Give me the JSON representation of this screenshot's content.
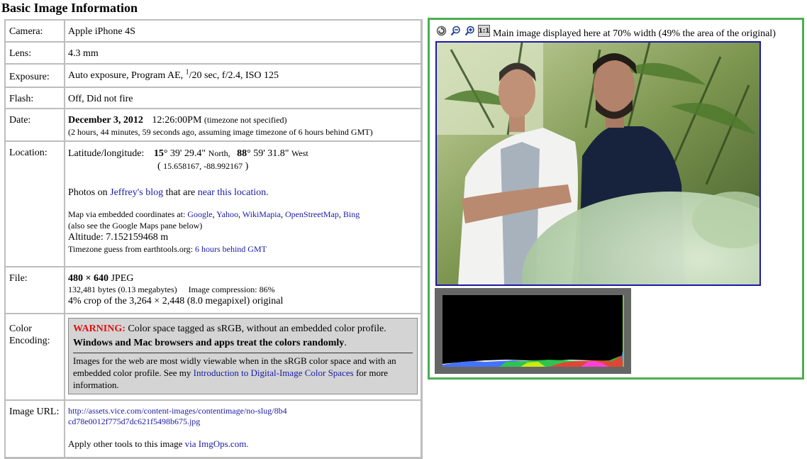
{
  "page_title": "Basic Image Information",
  "camera": {
    "label": "Camera:",
    "value": "Apple iPhone 4S"
  },
  "lens": {
    "label": "Lens:",
    "value": "4.3 mm"
  },
  "exposure": {
    "label": "Exposure:",
    "text_before": "Auto exposure, Program AE,",
    "frac_num": "1",
    "text_after": "/20 sec, f/2.4, ISO 125"
  },
  "flash": {
    "label": "Flash:",
    "value": "Off, Did not fire"
  },
  "date": {
    "label": "Date:",
    "date": "December 3, 2012",
    "time": "12:26:00PM",
    "tz_note": "(timezone not specified)",
    "ago": "(2 hours, 44 minutes, 59 seconds ago, assuming image timezone of 6 hours behind GMT)"
  },
  "location": {
    "label": "Location:",
    "latlon_label": "Latitude/longitude:",
    "lat_deg": "15",
    "lat_rest": "° 39' 29.4\"",
    "lat_dir": "North,",
    "lon_deg": "88",
    "lon_rest": "° 59' 31.8\"",
    "lon_dir": "West",
    "decimal_open": "(",
    "decimal": "15.658167, -88.992167",
    "decimal_close": ")",
    "photos_prefix": "Photos on",
    "blog_link": "Jeffrey's blog",
    "photos_mid": "that are",
    "near_link": "near this location.",
    "map_prefix": "Map via embedded coordinates at:",
    "map_links": [
      "Google",
      "Yahoo",
      "WikiMapia",
      "OpenStreetMap",
      "Bing"
    ],
    "map_note": "(also see the Google Maps pane below)",
    "altitude": "Altitude: 7.152159468 m",
    "tz_prefix": "Timezone guess from earthtools.org:",
    "tz_link": "6 hours behind GMT"
  },
  "file": {
    "label": "File:",
    "dims": "480 × 640",
    "format": "JPEG",
    "bytes": "132,481 bytes (0.13 megabytes)",
    "compression": "Image compression: 86%",
    "crop": "4% crop of the 3,264 × 2,448 (8.0 megapixel) original"
  },
  "color_encoding": {
    "label": "Color Encoding:",
    "warning_label": "WARNING:",
    "warning_text": "Color space tagged as sRGB, without an embedded color profile.",
    "warning_bold": "Windows and Mac browsers and apps treat the colors randomly",
    "warning_end": ".",
    "more_text": "Images for the web are most widly viewable when in the sRGB color space and with an embedded color profile. See my",
    "more_link": "Introduction to Digital-Image Color Spaces",
    "more_end": "for more information."
  },
  "image_url": {
    "label": "Image URL:",
    "url": "http://assets.vice.com/content-images/contentimage/no-slug/8b4cd78e0012f775d7dc621f5498b675.jpg",
    "tools_prefix": "Apply other tools to this image",
    "tools_link": "via ImgOps.com."
  },
  "viewer": {
    "caption": "Main image displayed here at 70% width (49% the area of the original)",
    "tool_1to1": "1:1",
    "icons": [
      "reset-icon",
      "zoom-out-icon",
      "zoom-in-icon"
    ]
  },
  "colors": {
    "link": "#1a1aa6",
    "warning": "#e01010",
    "panel_border": "#4caf50",
    "warning_bg": "#d4d4d4"
  }
}
